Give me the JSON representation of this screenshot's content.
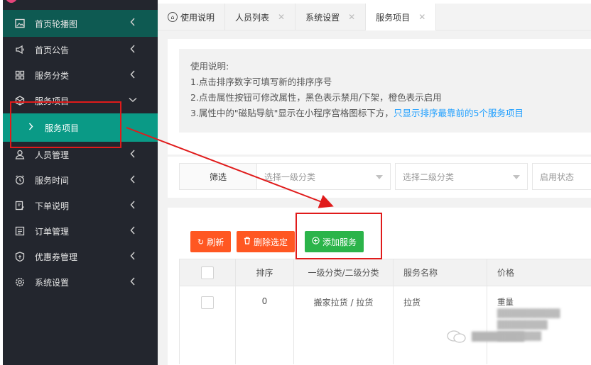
{
  "sidebar": {
    "items": [
      {
        "label": "首页轮播图",
        "icon": "image-icon",
        "arrow": "left"
      },
      {
        "label": "首页公告",
        "icon": "megaphone-icon",
        "arrow": "left"
      },
      {
        "label": "服务分类",
        "icon": "grid-icon",
        "arrow": "left"
      },
      {
        "label": "服务项目",
        "icon": "cube-icon",
        "arrow": "down"
      },
      {
        "label": "人员管理",
        "icon": "user-icon",
        "arrow": "left"
      },
      {
        "label": "服务时间",
        "icon": "clock-icon",
        "arrow": "left"
      },
      {
        "label": "下单说明",
        "icon": "edit-icon",
        "arrow": "left"
      },
      {
        "label": "订单管理",
        "icon": "list-icon",
        "arrow": "left"
      },
      {
        "label": "优惠券管理",
        "icon": "coupon-icon",
        "arrow": "left"
      },
      {
        "label": "系统设置",
        "icon": "gear-icon",
        "arrow": "left"
      }
    ],
    "submenu": {
      "label": "服务项目"
    }
  },
  "tabs": [
    {
      "label": "使用说明",
      "closable": false,
      "active": false
    },
    {
      "label": "人员列表",
      "closable": true,
      "active": false
    },
    {
      "label": "系统设置",
      "closable": true,
      "active": false
    },
    {
      "label": "服务项目",
      "closable": true,
      "active": true
    }
  ],
  "notice": {
    "title": "使用说明:",
    "line1": "1.点击排序数字可填写新的排序序号",
    "line2": "2.点击属性按钮可修改属性，黑色表示禁用/下架，橙色表示启用",
    "line3_prefix": "3.属性中的\"磁贴导航\"显示在小程序宫格图标下方，",
    "line3_highlight": "只显示排序最靠前的5个服务项目"
  },
  "filter": {
    "label": "筛选",
    "select1_placeholder": "选择一级分类",
    "select2_placeholder": "选择二级分类",
    "select3_placeholder": "启用状态"
  },
  "toolbar": {
    "refresh_label": "刷新",
    "delete_label": "删除选定",
    "add_label": "添加服务"
  },
  "table": {
    "headers": [
      "",
      "排序",
      "一级分类/二级分类",
      "服务名称",
      "价格"
    ],
    "rows": [
      {
        "sort": "0",
        "category": "搬家拉货 / 拉货",
        "name": "拉货",
        "price_title": "重量"
      }
    ]
  },
  "colors": {
    "sidebar_bg": "#23262e",
    "submenu_active": "#0a9a86",
    "orange": "#ff5722",
    "green": "#2bb44a",
    "highlight": "#1e9fff",
    "annotation": "#e01b1b"
  }
}
